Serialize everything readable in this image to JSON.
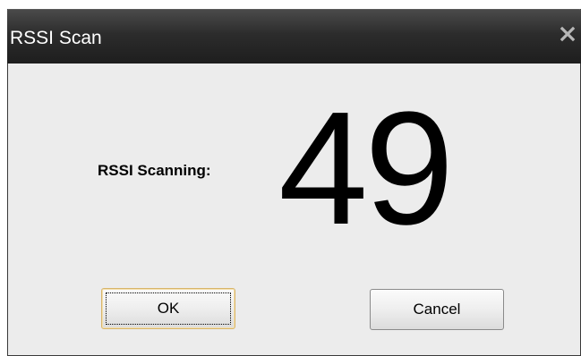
{
  "window": {
    "title": "RSSI Scan"
  },
  "scan": {
    "label": "RSSI Scanning:",
    "value": "49"
  },
  "buttons": {
    "ok_label": "OK",
    "cancel_label": "Cancel"
  },
  "icons": {
    "close": "close-icon"
  },
  "colors": {
    "titlebar": "#2c2c2c",
    "title_text": "#ffffff",
    "dialog_background": "#ececec",
    "default_button_border": "#d8b56a"
  }
}
